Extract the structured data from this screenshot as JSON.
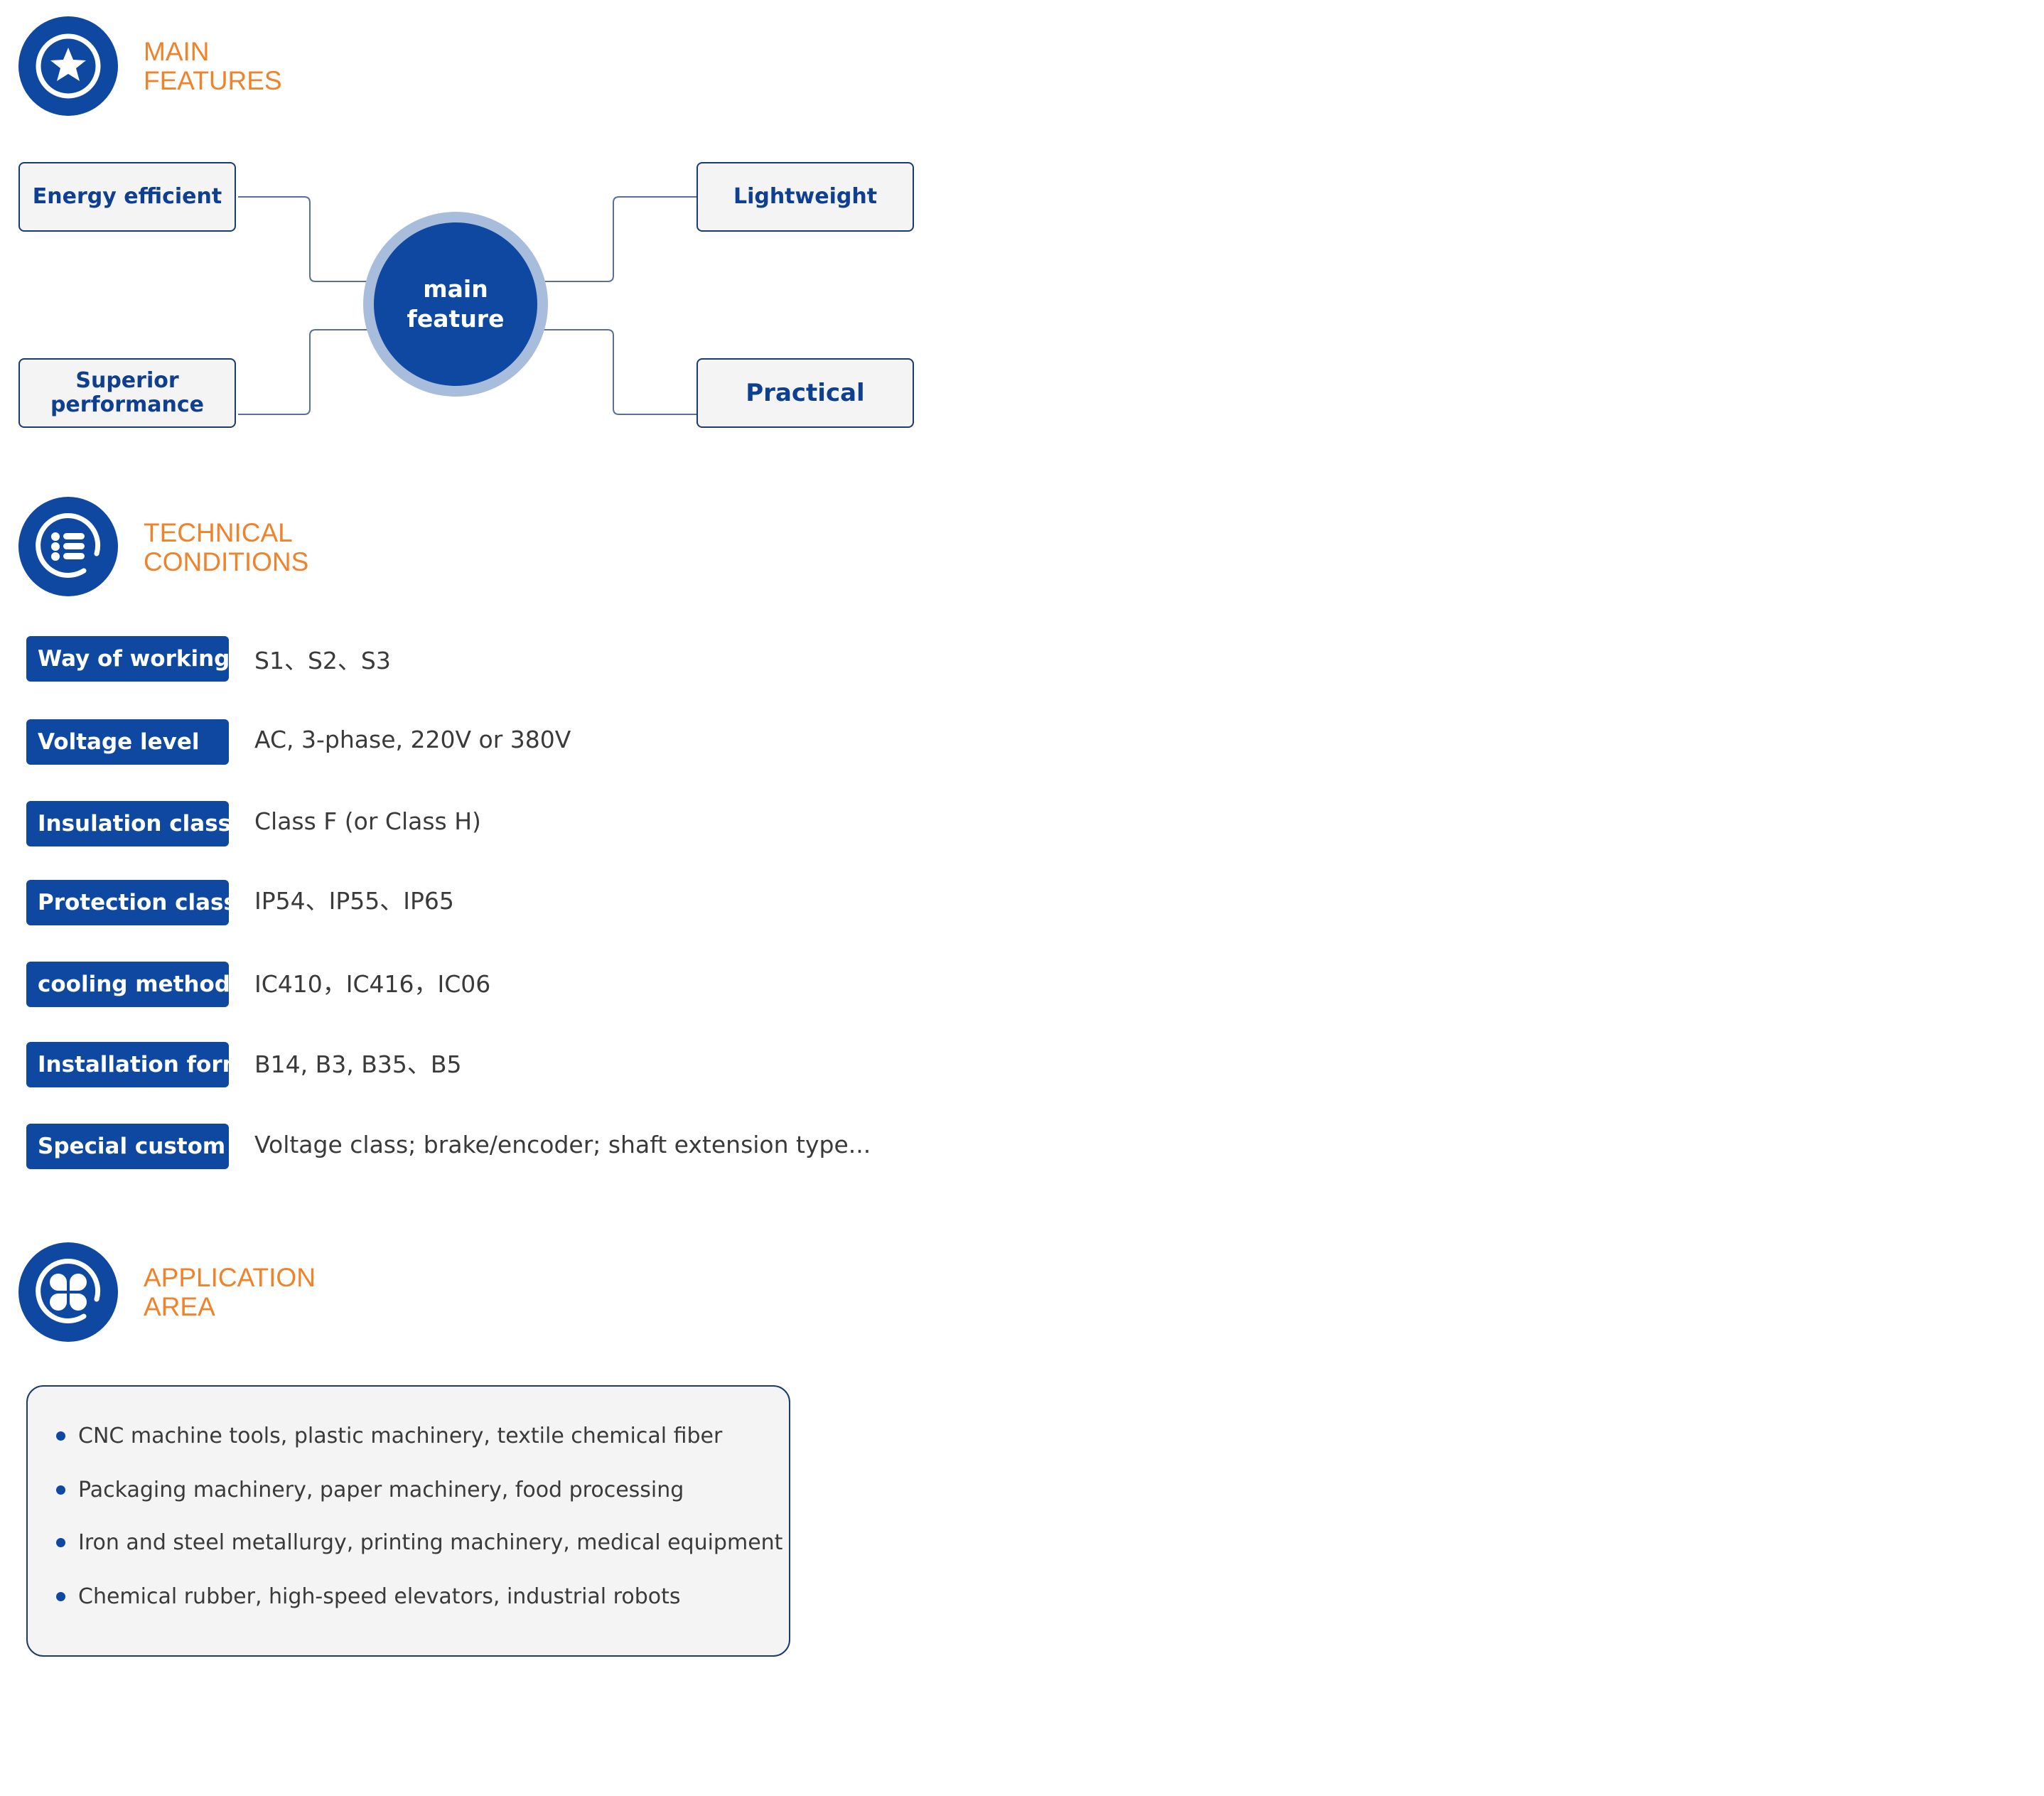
{
  "colors": {
    "brand_blue": "#0e48a1",
    "accent_orange": "#f0822a",
    "box_border": "#1c3a6e",
    "box_fill": "#f4f4f4",
    "ring": "#a8bcdc"
  },
  "main_features": {
    "icon": "star-badge-icon",
    "title_line1": "MAIN",
    "title_line2": "FEATURES",
    "center_line1": "main",
    "center_line2": "feature",
    "items": [
      {
        "label": "Energy efficient"
      },
      {
        "label": "Lightweight"
      },
      {
        "label": "Superior performance",
        "line1": "Superior",
        "line2": "performance"
      },
      {
        "label": "Practical"
      }
    ]
  },
  "technical_conditions": {
    "icon": "list-icon",
    "title_line1": "TECHNICAL",
    "title_line2": "CONDITIONS",
    "rows": [
      {
        "label": "Way of working",
        "value": "S1、S2、S3"
      },
      {
        "label": "Voltage level",
        "value": "AC, 3-phase, 220V or 380V"
      },
      {
        "label": "Insulation class",
        "value": "Class F (or Class H)"
      },
      {
        "label": "Protection class",
        "value": "IP54、IP55、IP65"
      },
      {
        "label": "cooling method",
        "value": "IC410，IC416，IC06"
      },
      {
        "label": "Installation form",
        "value": "B14, B3, B35、B5"
      },
      {
        "label": "Special custom",
        "value": "Voltage class; brake/encoder; shaft extension type..."
      }
    ]
  },
  "application_area": {
    "icon": "clover-grid-icon",
    "title_line1": "APPLICATION",
    "title_line2": "AREA",
    "items": [
      "CNC machine tools, plastic machinery, textile chemical fiber",
      "Packaging machinery, paper machinery, food processing",
      "Iron and steel metallurgy, printing machinery, medical equipment",
      "Chemical rubber, high-speed elevators, industrial robots"
    ]
  }
}
